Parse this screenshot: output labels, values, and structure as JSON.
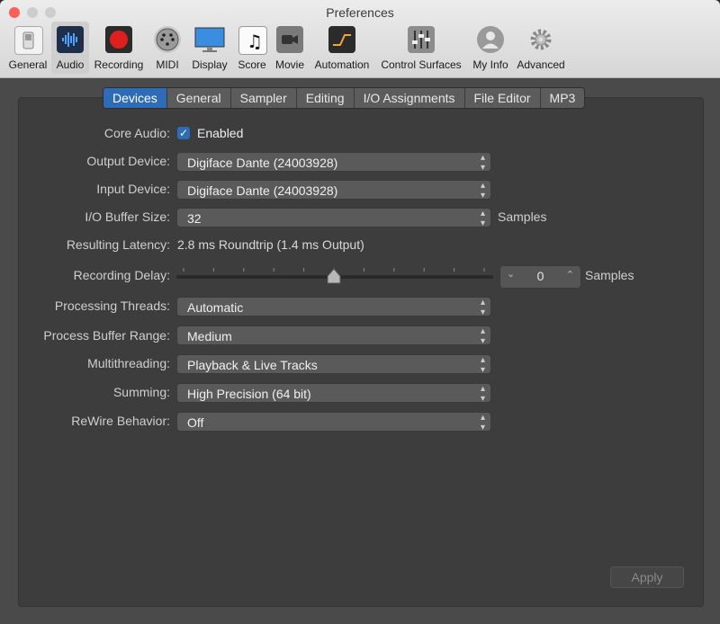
{
  "window": {
    "title": "Preferences"
  },
  "colors": {
    "accent": "#2f6cb7",
    "close": "#fc5f57",
    "minimize": "#c9c9c9",
    "zoom": "#c9c9c9"
  },
  "toolbar": {
    "items": [
      {
        "label": "General",
        "icon": "switch-icon"
      },
      {
        "label": "Audio",
        "icon": "waveform-icon",
        "selected": true
      },
      {
        "label": "Recording",
        "icon": "record-icon"
      },
      {
        "label": "MIDI",
        "icon": "midi-port-icon"
      },
      {
        "label": "Display",
        "icon": "monitor-icon"
      },
      {
        "label": "Score",
        "icon": "music-note-icon"
      },
      {
        "label": "Movie",
        "icon": "camera-icon"
      },
      {
        "label": "Automation",
        "icon": "automation-curve-icon"
      },
      {
        "label": "Control Surfaces",
        "icon": "faders-icon"
      },
      {
        "label": "My Info",
        "icon": "person-icon"
      },
      {
        "label": "Advanced",
        "icon": "gear-icon"
      }
    ]
  },
  "tabs": [
    "Devices",
    "General",
    "Sampler",
    "Editing",
    "I/O Assignments",
    "File Editor",
    "MP3"
  ],
  "active_tab": "Devices",
  "settings": {
    "core_audio_label": "Core Audio:",
    "core_audio_value": "Enabled",
    "output_device_label": "Output Device:",
    "output_device_value": "Digiface Dante (24003928)",
    "input_device_label": "Input Device:",
    "input_device_value": "Digiface Dante (24003928)",
    "buffer_label": "I/O Buffer Size:",
    "buffer_value": "32",
    "buffer_unit": "Samples",
    "latency_label": "Resulting Latency:",
    "latency_value": "2.8 ms Roundtrip (1.4 ms Output)",
    "rec_delay_label": "Recording Delay:",
    "rec_delay_value": "0",
    "rec_delay_unit": "Samples",
    "rec_delay_slider_fraction": 0.5,
    "threads_label": "Processing Threads:",
    "threads_value": "Automatic",
    "range_label": "Process Buffer Range:",
    "range_value": "Medium",
    "multithreading_label": "Multithreading:",
    "multithreading_value": "Playback & Live Tracks",
    "summing_label": "Summing:",
    "summing_value": "High Precision (64 bit)",
    "rewire_label": "ReWire Behavior:",
    "rewire_value": "Off"
  },
  "apply_label": "Apply"
}
